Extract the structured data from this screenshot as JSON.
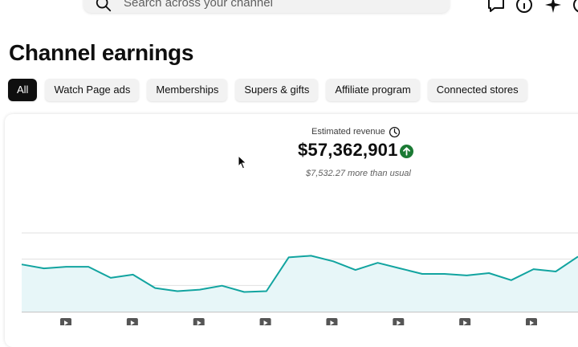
{
  "header": {
    "search": {
      "placeholder": "Search across your channel"
    },
    "icons": [
      "search-icon",
      "feedback-icon",
      "help-icon",
      "sparkle-icon"
    ]
  },
  "page": {
    "title": "Channel earnings"
  },
  "filters": {
    "chips": [
      "All",
      "Watch Page ads",
      "Memberships",
      "Supers & gifts",
      "Affiliate program",
      "Connected stores"
    ],
    "selected": "All"
  },
  "summary": {
    "label": "Estimated revenue",
    "value": "$57,362,901",
    "trend": "up",
    "comparison": "$7,532.27 more than usual"
  },
  "colors": {
    "accent": "#12a4a0",
    "chip_active_bg": "#0f0f0f",
    "trend_up": "#1b7a34"
  },
  "chart_data": {
    "type": "area",
    "ylim": [
      0,
      100
    ],
    "values": [
      60,
      55,
      57,
      57,
      43,
      47,
      30,
      26,
      28,
      33,
      25,
      26,
      69,
      71,
      64,
      53,
      62,
      55,
      48,
      48,
      46,
      49,
      40,
      54,
      51,
      70
    ],
    "grid": true,
    "markers": 8
  }
}
